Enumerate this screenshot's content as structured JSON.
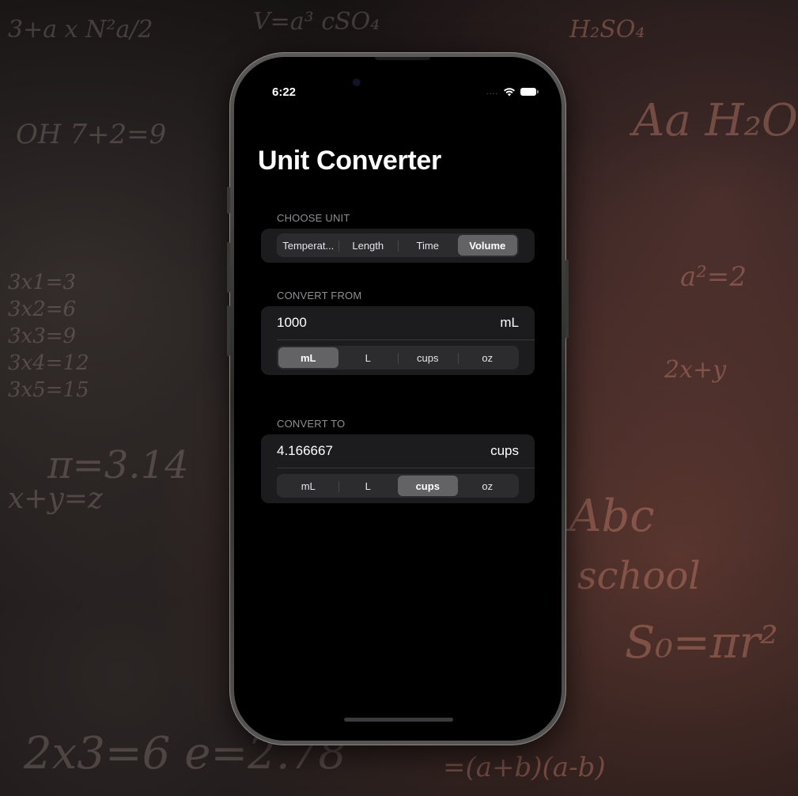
{
  "status_bar": {
    "time": "6:22",
    "signal_dots": "....",
    "wifi_icon": "wifi-icon",
    "battery_icon": "battery-icon"
  },
  "app": {
    "title": "Unit Converter"
  },
  "choose_unit": {
    "header": "CHOOSE UNIT",
    "options": [
      "Temperat...",
      "Length",
      "Time",
      "Volume"
    ],
    "selected": "Volume"
  },
  "convert_from": {
    "header": "CONVERT FROM",
    "value": "1000",
    "unit_label": "mL",
    "options": [
      "mL",
      "L",
      "cups",
      "oz"
    ],
    "selected": "mL"
  },
  "convert_to": {
    "header": "CONVERT TO",
    "value": "4.166667",
    "unit_label": "cups",
    "options": [
      "mL",
      "L",
      "cups",
      "oz"
    ],
    "selected": "cups"
  },
  "colors": {
    "background": "#000000",
    "card": "#1c1c1e",
    "segment_track": "#2c2c2e",
    "segment_selected": "#636366",
    "section_header": "#8e8e93"
  }
}
